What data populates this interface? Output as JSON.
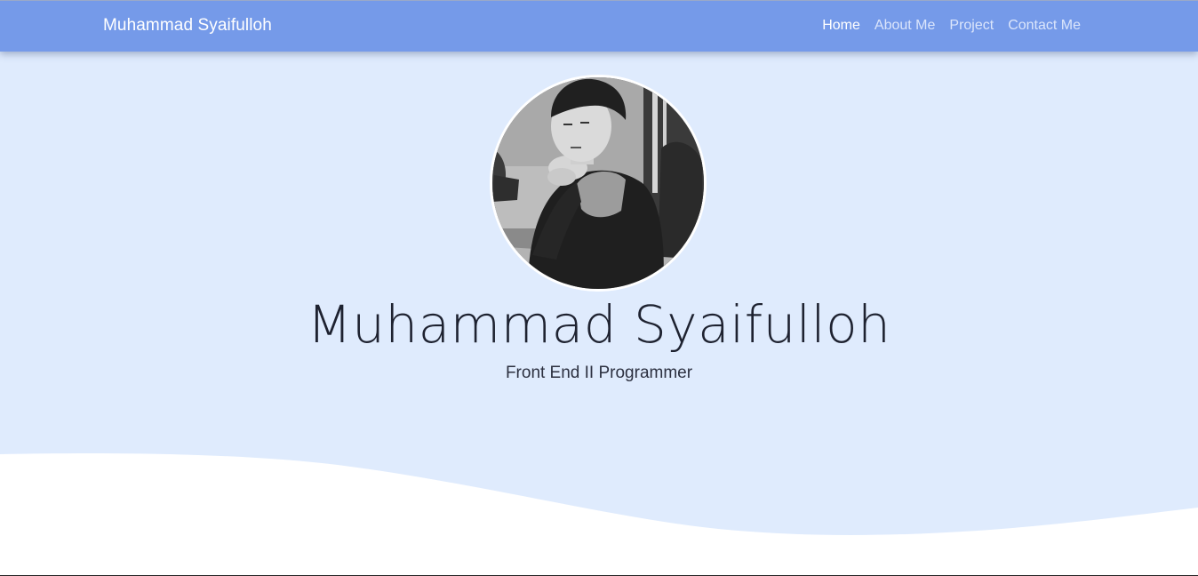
{
  "navbar": {
    "brand": "Muhammad Syaifulloh",
    "links": [
      {
        "label": "Home",
        "active": true
      },
      {
        "label": "About Me",
        "active": false
      },
      {
        "label": "Project",
        "active": false
      },
      {
        "label": "Contact Me",
        "active": false
      }
    ]
  },
  "hero": {
    "name": "Muhammad Syaifulloh",
    "subtitle": "Front End II Programmer"
  },
  "colors": {
    "navbar_bg": "#759ae9",
    "hero_bg": "#dfebfd",
    "wave": "#ffffff"
  }
}
